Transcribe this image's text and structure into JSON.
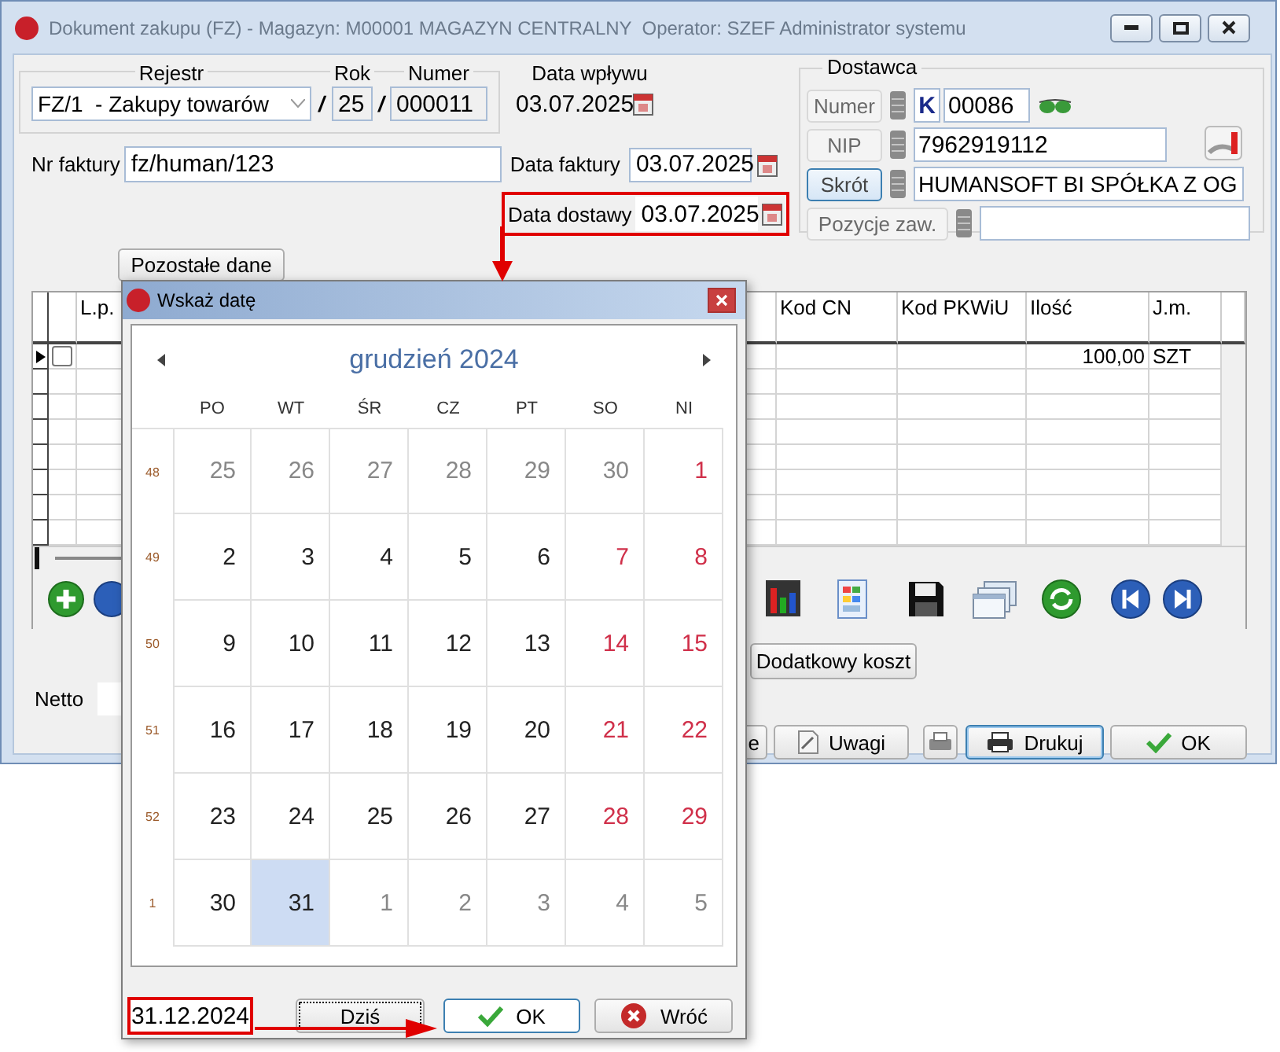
{
  "window": {
    "title": "Dokument zakupu (FZ) - Magazyn: M00001 MAGAZYN CENTRALNY  Operator: SZEF Administrator systemu"
  },
  "header": {
    "rejestr_label": "Rejestr",
    "rok_label": "Rok",
    "numer_label": "Numer",
    "data_wplywu_label": "Data wpływu",
    "rejestr": "FZ/1  - Zakupy towarów",
    "separator_1": "/",
    "rok": "25",
    "separator_2": "/",
    "numer": "000011",
    "data_wplywu": "03.07.2025"
  },
  "invoice": {
    "nr_faktury_label": "Nr faktury",
    "nr_faktury": "fz/human/123",
    "data_faktury_label": "Data faktury",
    "data_faktury": "03.07.2025",
    "data_dostawy_label": "Data dostawy",
    "data_dostawy": "03.07.2025",
    "data_dostawy_highlighted": true
  },
  "pozostale_button": "Pozostałe dane",
  "supplier": {
    "title": "Dostawca",
    "rows": [
      {
        "kind": "numer",
        "button": "Numer",
        "prefix": "K",
        "value": "00086",
        "focused": false
      },
      {
        "kind": "nip",
        "button": "NIP",
        "value": "7962919112",
        "focused": false
      },
      {
        "kind": "skrot",
        "button": "Skrót",
        "value": "HUMANSOFT BI SPÓŁKA Z OG",
        "focused": true
      },
      {
        "kind": "pozycje",
        "button": "Pozycje zaw.",
        "focused": false
      }
    ]
  },
  "table": {
    "columns": [
      {
        "kind": "lp",
        "label": "L.p."
      },
      {
        "kind": "kod_cn",
        "label": "Kod CN"
      },
      {
        "kind": "kod_pkwiu",
        "label": "Kod PKWiU"
      },
      {
        "kind": "ilosc",
        "label": "Ilość"
      },
      {
        "kind": "jm",
        "label": "J.m."
      }
    ],
    "rows": [
      {
        "current": true,
        "checked": false,
        "ilosc": "100,00",
        "jm": "SZT"
      }
    ]
  },
  "dodatkowy_koszt_button": "Dodatkowy koszt",
  "netto_label": "Netto",
  "bottom_buttons": [
    {
      "kind": "text",
      "label": "e",
      "default": false
    },
    {
      "kind": "uwagi",
      "label": "Uwagi",
      "default": false
    },
    {
      "kind": "print_settings",
      "default": false
    },
    {
      "kind": "drukuj",
      "label": "Drukuj",
      "default": true
    },
    {
      "kind": "ok",
      "label": "OK",
      "default": false
    }
  ],
  "dialog": {
    "title": "Wskaż datę",
    "month": "grudzień 2024",
    "weekdays": [
      "PO",
      "WT",
      "ŚR",
      "CZ",
      "PT",
      "SO",
      "NI"
    ],
    "weeks": [
      {
        "number": "48",
        "days": [
          {
            "label": "25",
            "in_month": false,
            "selected": false
          },
          {
            "label": "26",
            "in_month": false,
            "selected": false
          },
          {
            "label": "27",
            "in_month": false,
            "selected": false
          },
          {
            "label": "28",
            "in_month": false,
            "selected": false
          },
          {
            "label": "29",
            "in_month": false,
            "selected": false
          },
          {
            "label": "30",
            "in_month": false,
            "selected": false
          },
          {
            "label": "1",
            "in_month": true,
            "selected": false
          }
        ]
      },
      {
        "number": "49",
        "days": [
          {
            "label": "2",
            "in_month": true,
            "selected": false
          },
          {
            "label": "3",
            "in_month": true,
            "selected": false
          },
          {
            "label": "4",
            "in_month": true,
            "selected": false
          },
          {
            "label": "5",
            "in_month": true,
            "selected": false
          },
          {
            "label": "6",
            "in_month": true,
            "selected": false
          },
          {
            "label": "7",
            "in_month": true,
            "selected": false
          },
          {
            "label": "8",
            "in_month": true,
            "selected": false
          }
        ]
      },
      {
        "number": "50",
        "days": [
          {
            "label": "9",
            "in_month": true,
            "selected": false
          },
          {
            "label": "10",
            "in_month": true,
            "selected": false
          },
          {
            "label": "11",
            "in_month": true,
            "selected": false
          },
          {
            "label": "12",
            "in_month": true,
            "selected": false
          },
          {
            "label": "13",
            "in_month": true,
            "selected": false
          },
          {
            "label": "14",
            "in_month": true,
            "selected": false
          },
          {
            "label": "15",
            "in_month": true,
            "selected": false
          }
        ]
      },
      {
        "number": "51",
        "days": [
          {
            "label": "16",
            "in_month": true,
            "selected": false
          },
          {
            "label": "17",
            "in_month": true,
            "selected": false
          },
          {
            "label": "18",
            "in_month": true,
            "selected": false
          },
          {
            "label": "19",
            "in_month": true,
            "selected": false
          },
          {
            "label": "20",
            "in_month": true,
            "selected": false
          },
          {
            "label": "21",
            "in_month": true,
            "selected": false
          },
          {
            "label": "22",
            "in_month": true,
            "selected": false
          }
        ]
      },
      {
        "number": "52",
        "days": [
          {
            "label": "23",
            "in_month": true,
            "selected": false
          },
          {
            "label": "24",
            "in_month": true,
            "selected": false
          },
          {
            "label": "25",
            "in_month": true,
            "selected": false
          },
          {
            "label": "26",
            "in_month": true,
            "selected": false
          },
          {
            "label": "27",
            "in_month": true,
            "selected": false
          },
          {
            "label": "28",
            "in_month": true,
            "selected": false
          },
          {
            "label": "29",
            "in_month": true,
            "selected": false
          }
        ]
      },
      {
        "number": "1",
        "days": [
          {
            "label": "30",
            "in_month": true,
            "selected": false
          },
          {
            "label": "31",
            "in_month": true,
            "selected": true
          },
          {
            "label": "1",
            "in_month": false,
            "selected": false
          },
          {
            "label": "2",
            "in_month": false,
            "selected": false
          },
          {
            "label": "3",
            "in_month": false,
            "selected": false
          },
          {
            "label": "4",
            "in_month": false,
            "selected": false
          },
          {
            "label": "5",
            "in_month": false,
            "selected": false
          }
        ]
      }
    ],
    "date_value": "31.12.2024",
    "date_value_highlighted": true,
    "buttons": [
      {
        "kind": "today",
        "label": "Dziś",
        "focused": true
      },
      {
        "kind": "ok",
        "label": "OK",
        "focused": false
      },
      {
        "kind": "cancel",
        "label": "Wróć",
        "focused": false
      }
    ]
  }
}
